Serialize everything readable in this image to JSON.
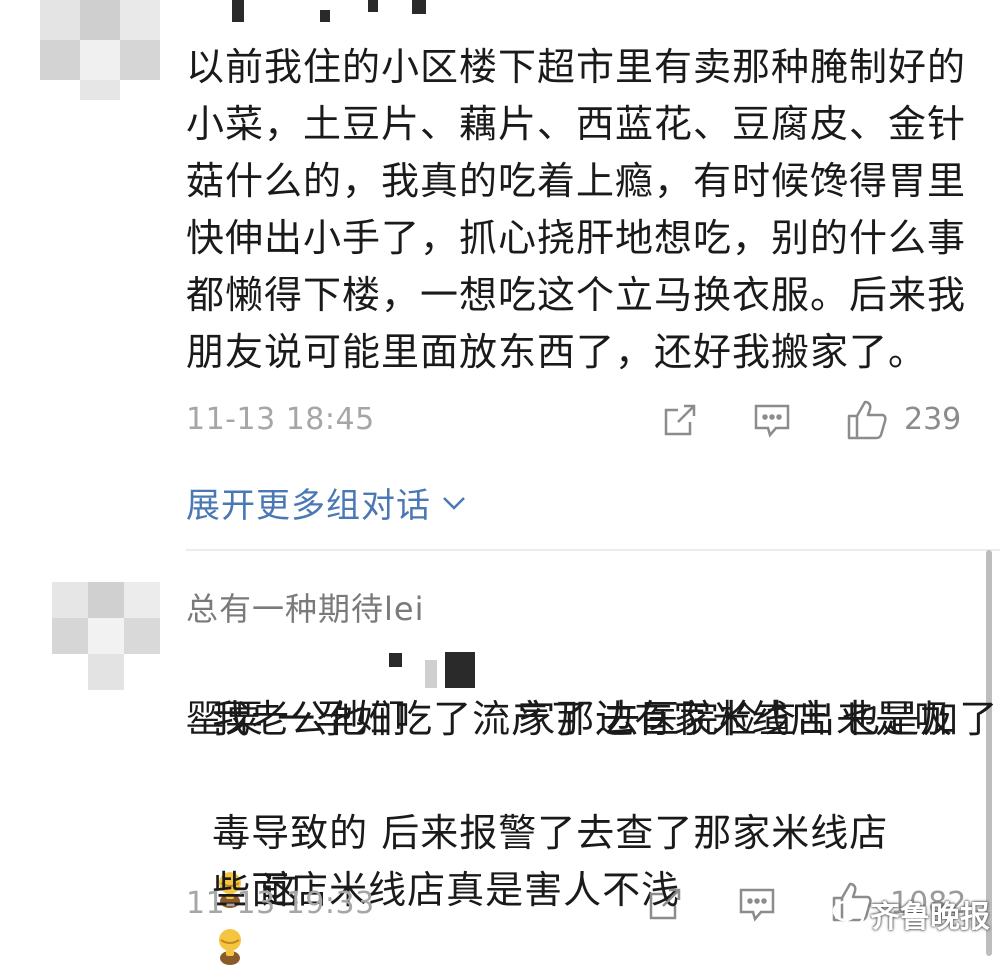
{
  "comments": [
    {
      "text": "以前我住的小区楼下超市里有卖那种腌制好的\n小菜，土豆片、藕片、西蓝花、豆腐皮、金针\n菇什么的，我真的吃着上瘾，有时候馋得胃里\n快伸出小手了，抓心挠肝地想吃，别的什么事\n都懒得下楼，一想吃这个立马换衣服。后来我\n朋友说可能里面放东西了，还好我搬家了。",
      "timestamp": "11-13 18:45",
      "likes": "239"
    },
    {
      "username": "总有一种期待lei",
      "line1_pre": "我老公他们",
      "line1_post": "家那边有家米线店 也是加了",
      "line2": "罂粟 一孕妇吃了流产了 去医院检查出来是吸",
      "line3": "毒导致的 后来报警了去查了那家米线店",
      "line3_post": " 这",
      "line4": "些面店米线店真是害人不浅",
      "timestamp": "11-13 19:33",
      "likes": "1082"
    }
  ],
  "expand_label": "展开更多组对话",
  "watermark": "齐鲁晚报",
  "icons": {
    "share": "share-icon",
    "comment": "comment-icon",
    "like": "thumbs-up-icon",
    "chevron": "chevron-down-icon",
    "emoji": "facepalm-emoji"
  }
}
